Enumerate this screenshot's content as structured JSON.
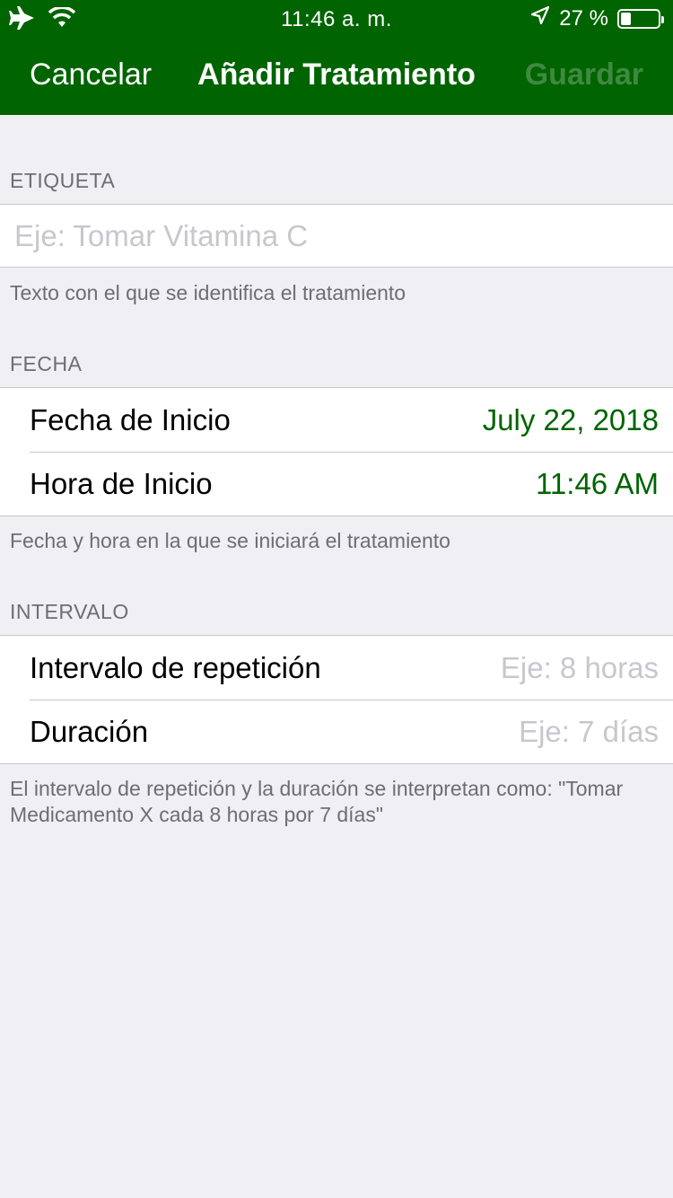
{
  "status_bar": {
    "time": "11:46 a. m.",
    "battery": "27 %",
    "battery_level": 0.27,
    "icons": [
      "airplane-icon",
      "wifi-icon",
      "location-arrow-icon",
      "battery-icon"
    ]
  },
  "nav": {
    "cancel_label": "Cancelar",
    "title": "Añadir Tratamiento",
    "save_label": "Guardar"
  },
  "etiqueta": {
    "header": "ETIQUETA",
    "placeholder": "Eje: Tomar Vitamina C",
    "value": "",
    "footer": "Texto con el que se identifica el tratamiento"
  },
  "fecha": {
    "header": "FECHA",
    "rows": [
      {
        "label": "Fecha de Inicio",
        "value": "July 22, 2018"
      },
      {
        "label": "Hora de Inicio",
        "value": "11:46 AM"
      }
    ],
    "footer": "Fecha y hora en la que se iniciará el tratamiento"
  },
  "intervalo": {
    "header": "INTERVALO",
    "rows": [
      {
        "label": "Intervalo de repetición",
        "placeholder": "Eje: 8 horas"
      },
      {
        "label": "Duración",
        "placeholder": "Eje: 7 días"
      }
    ],
    "footer": "El intervalo de repetición y la duración se interpretan como: \"Tomar Medicamento X cada 8 horas por 7 días\""
  },
  "colors": {
    "nav_background": "#006400",
    "accent": "#006400",
    "disabled_save": "#3f8a3f",
    "page_background": "#efeff4"
  }
}
